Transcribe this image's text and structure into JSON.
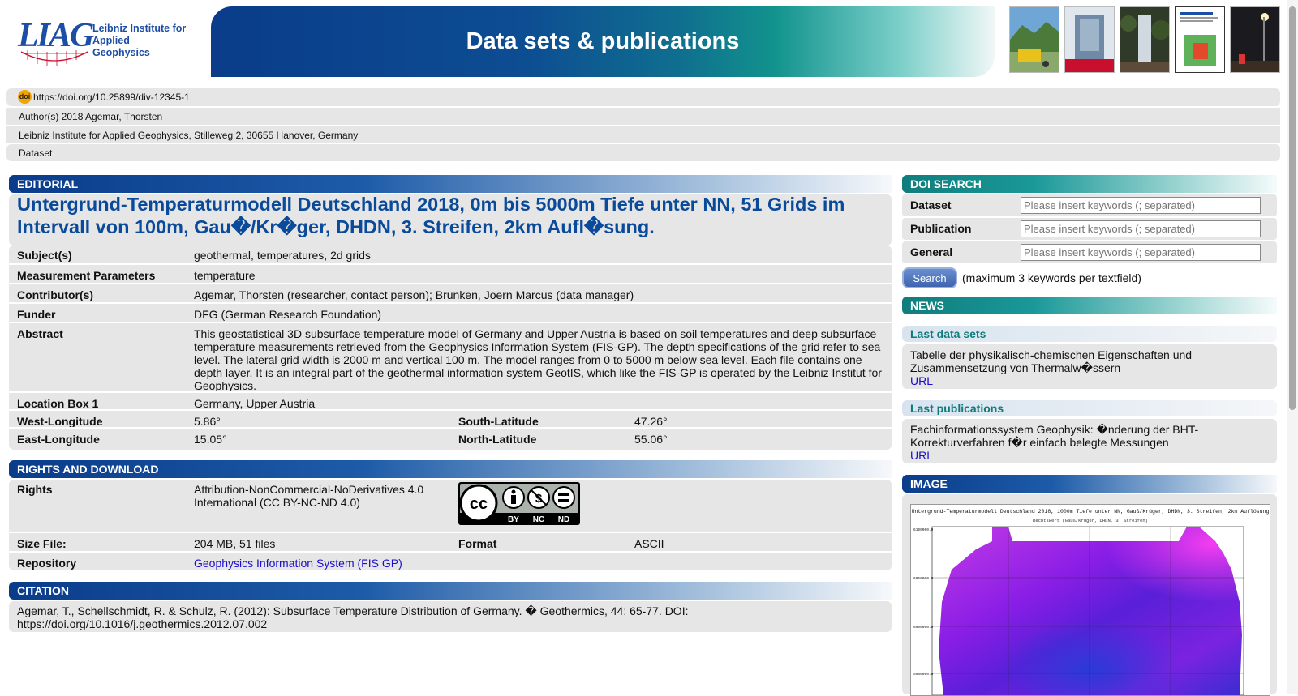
{
  "header": {
    "logo_mark": "LIAG",
    "logo_line1": "Leibniz Institute for",
    "logo_line2": "Applied Geophysics",
    "title": "Data sets & publications"
  },
  "meta": {
    "doi_badge": "doi",
    "doi": "https://doi.org/10.25899/div-12345-1",
    "authors": "Author(s) 2018 Agemar, Thorsten",
    "institute": "Leibniz Institute for Applied Geophysics, Stilleweg 2, 30655 Hanover, Germany",
    "type": "Dataset"
  },
  "editorial": {
    "header": "EDITORIAL",
    "title": "Untergrund-Temperaturmodell Deutschland 2018, 0m bis 5000m Tiefe unter NN, 51 Grids im Intervall von 100m, Gau�/Kr�ger, DHDN, 3. Streifen, 2km Aufl�sung.",
    "subjects_label": "Subject(s)",
    "subjects": "geothermal, temperatures, 2d grids",
    "params_label": "Measurement Parameters",
    "params": "temperature",
    "contrib_label": "Contributor(s)",
    "contrib": "Agemar, Thorsten (researcher, contact person); Brunken, Joern Marcus (data manager)",
    "funder_label": "Funder",
    "funder": "DFG (German Research Foundation)",
    "abstract_label": "Abstract",
    "abstract": "This geostatistical 3D subsurface temperature model of Germany and Upper Austria is based on soil temperatures and deep subsurface temperature measurements retrieved from the Geophysics Information System (FIS-GP). The depth specifications of the grid refer to sea level. The lateral grid width is 2000 m and vertical 100 m. The model ranges from 0 to 5000 m below sea level. Each file contains one depth layer. It is an integral part of the geothermal information system GeotIS, which like the FIS-GP is operated by the Leibniz Institut for Geophysics.",
    "location_label": "Location Box 1",
    "location": "Germany, Upper Austria",
    "west_label": "West-Longitude",
    "west": "5.86°",
    "south_label": "South-Latitude",
    "south": "47.26°",
    "east_label": "East-Longitude",
    "east": "15.05°",
    "north_label": "North-Latitude",
    "north": "55.06°"
  },
  "rights": {
    "header": "RIGHTS AND DOWNLOAD",
    "rights_label": "Rights",
    "rights": "Attribution-NonCommercial-NoDerivatives 4.0 International (CC BY-NC-ND 4.0)",
    "cc_by": "BY",
    "cc_nc": "NC",
    "cc_nd": "ND",
    "size_label": "Size File:",
    "size": "204 MB, 51 files",
    "format_label": "Format",
    "format": "ASCII",
    "repo_label": "Repository",
    "repo": "Geophysics Information System (FIS GP)"
  },
  "citation": {
    "header": "CITATION",
    "text": "Agemar, T., Schellschmidt, R. & Schulz, R. (2012): Subsurface Temperature Distribution of Germany. � Geothermics, 44: 65-77. DOI: https://doi.org/10.1016/j.geothermics.2012.07.002"
  },
  "doi_search": {
    "header": "DOI SEARCH",
    "dataset_label": "Dataset",
    "publication_label": "Publication",
    "general_label": "General",
    "placeholder": "Please insert keywords (; separated)",
    "button": "Search",
    "note": "(maximum 3 keywords per textfield)"
  },
  "news": {
    "header": "NEWS",
    "last_datasets_label": "Last data sets",
    "last_dataset": "Tabelle der physikalisch-chemischen Eigenschaften und Zusammensetzung von Thermalw�ssern",
    "url_label": "URL",
    "last_pubs_label": "Last publications",
    "last_pub": "Fachinformationssystem Geophysik: �nderung der BHT-Korrekturverfahren f�r einfach belegte Messungen"
  },
  "image": {
    "header": "IMAGE",
    "caption": "Untergrund-Temperaturmodell Deutschland 2018, 1000m Tiefe unter NN, Gauß/Krüger, DHDN, 3. Streifen, 2km Auflösung",
    "subcaption": "Rechtswert (Gauß/Krüger, DHDN, 3. Streifen)",
    "ytick1": "6100000.0",
    "ytick2": "6050000.0",
    "ytick3": "6000000.0",
    "ytick4": "5950000.0"
  },
  "colors": {
    "primary_blue": "#0a3c8a",
    "teal": "#0f7d7d",
    "link": "#1a0dcc"
  }
}
